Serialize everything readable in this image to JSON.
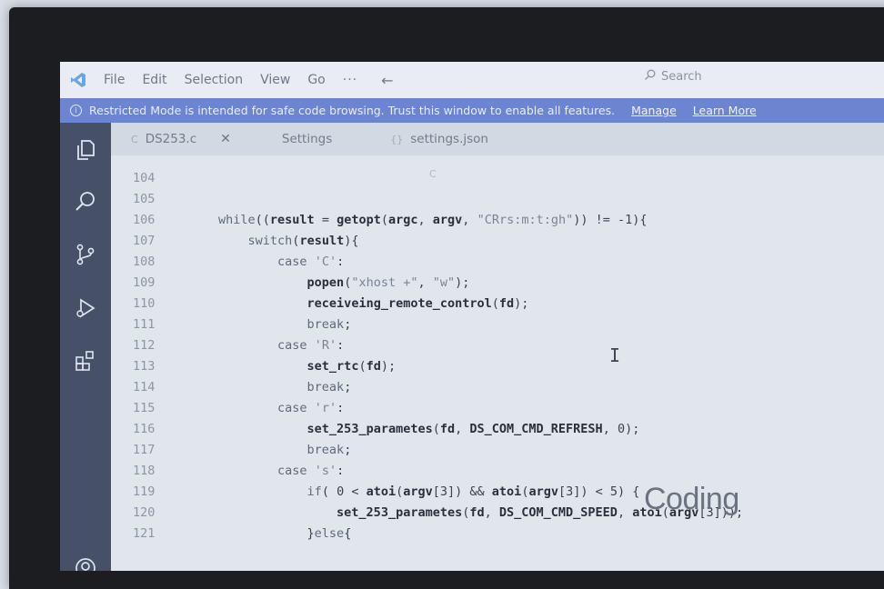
{
  "window": {
    "menu": [
      "File",
      "Edit",
      "Selection",
      "View",
      "Go"
    ],
    "more": "···",
    "search_placeholder": "Search"
  },
  "banner": {
    "message": "Restricted Mode is intended for safe code browsing. Trust this window to enable all features.",
    "manage": "Manage",
    "learn_more": "Learn More"
  },
  "tabs": [
    {
      "label": "DS253.c",
      "icon": "c-file-icon",
      "close": "✕"
    },
    {
      "label": "Settings",
      "icon": "settings-icon"
    },
    {
      "label": "settings.json",
      "icon": "json-file-icon"
    }
  ],
  "breadcrumb": "C",
  "activity_icons": [
    "explorer-icon",
    "search-icon",
    "source-control-icon",
    "run-debug-icon",
    "extensions-icon",
    "accounts-icon"
  ],
  "code": {
    "lines": [
      {
        "n": "104",
        "text": ""
      },
      {
        "n": "105",
        "text": ""
      },
      {
        "n": "106",
        "text": "while((result = getopt(argc, argv, \"CRrs:m:t:gh\")) != -1){"
      },
      {
        "n": "107",
        "text": "    switch(result){"
      },
      {
        "n": "108",
        "text": "        case 'C':"
      },
      {
        "n": "109",
        "text": "            popen(\"xhost +\", \"w\");"
      },
      {
        "n": "110",
        "text": "            receiveing_remote_control(fd);"
      },
      {
        "n": "111",
        "text": "            break;"
      },
      {
        "n": "112",
        "text": "        case 'R':"
      },
      {
        "n": "113",
        "text": "            set_rtc(fd);"
      },
      {
        "n": "114",
        "text": "            break;"
      },
      {
        "n": "115",
        "text": "        case 'r':"
      },
      {
        "n": "116",
        "text": "            set_253_parametes(fd, DS_COM_CMD_REFRESH, 0);"
      },
      {
        "n": "117",
        "text": "            break;"
      },
      {
        "n": "118",
        "text": "        case 's':"
      },
      {
        "n": "119",
        "text": "            if( 0 < atoi(argv[3]) && atoi(argv[3]) < 5) {"
      },
      {
        "n": "120",
        "text": "                set_253_parametes(fd, DS_COM_CMD_SPEED, atoi(argv[3]));"
      },
      {
        "n": "121",
        "text": "            }else{"
      }
    ]
  },
  "watermark": "Coding",
  "colors": {
    "banner": "#6d84d0",
    "activity_bar": "#465167",
    "editor_bg": "#e1e5ec"
  }
}
